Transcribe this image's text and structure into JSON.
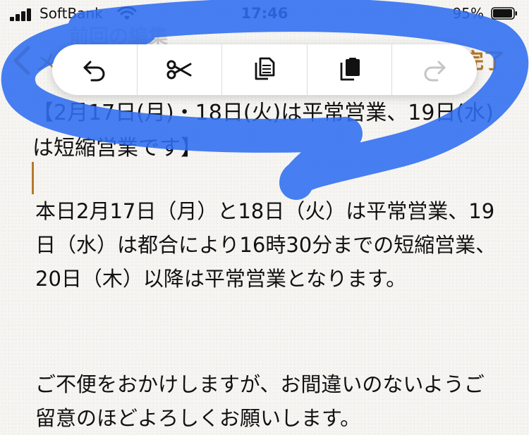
{
  "status_bar": {
    "carrier": "SoftBank",
    "time": "17:46",
    "battery_percent": "95%"
  },
  "nav": {
    "back_label": "メ",
    "faded_header": "前回の編集",
    "done_label": "完了"
  },
  "edit_menu": {
    "items": [
      "undo-icon",
      "cut-icon",
      "copy-icon",
      "paste-icon",
      "redo-icon"
    ]
  },
  "note": {
    "title": "【2月17日(月)・18日(火)は平常営業、19日(水)は短縮営業です】",
    "paragraphs": [
      "本日2月17日（月）と18日（火）は平常営業、19日（水）は都合により16時30分までの短縮営業、20日（木）以降は平常営業となります。",
      "ご不便をおかけしますが、お間違いのないようご留意のほどよろしくお願いします。"
    ]
  },
  "colors": {
    "accent": "#b5792b",
    "scribble": "#2f6df0"
  }
}
